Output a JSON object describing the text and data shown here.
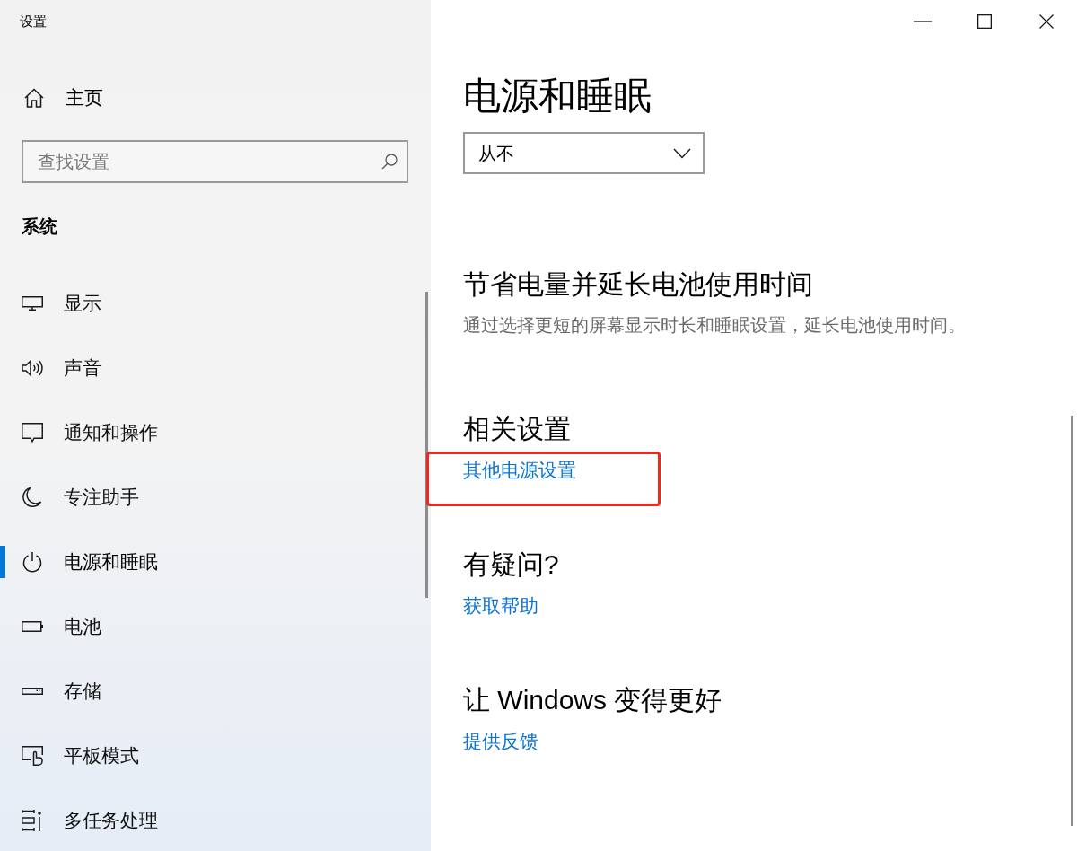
{
  "window": {
    "title": "设置"
  },
  "sidebar": {
    "home": {
      "label": "主页"
    },
    "search": {
      "placeholder": "查找设置"
    },
    "section": "系统",
    "items": [
      {
        "label": "显示",
        "selected": false
      },
      {
        "label": "声音",
        "selected": false
      },
      {
        "label": "通知和操作",
        "selected": false
      },
      {
        "label": "专注助手",
        "selected": false
      },
      {
        "label": "电源和睡眠",
        "selected": true
      },
      {
        "label": "电池",
        "selected": false
      },
      {
        "label": "存储",
        "selected": false
      },
      {
        "label": "平板模式",
        "selected": false
      },
      {
        "label": "多任务处理",
        "selected": false
      }
    ]
  },
  "content": {
    "title": "电源和睡眠",
    "dropdown": {
      "value": "从不"
    },
    "sections": [
      {
        "heading": "节省电量并延长电池使用时间",
        "description": "通过选择更短的屏幕显示时长和睡眠设置，延长电池使用时间。"
      },
      {
        "heading": "相关设置",
        "links": [
          {
            "label": "其他电源设置",
            "highlighted": true
          }
        ]
      },
      {
        "heading": "有疑问?",
        "links": [
          {
            "label": "获取帮助",
            "highlighted": false
          }
        ]
      },
      {
        "heading": "让 Windows 变得更好",
        "links": [
          {
            "label": "提供反馈",
            "highlighted": false
          }
        ]
      }
    ]
  }
}
